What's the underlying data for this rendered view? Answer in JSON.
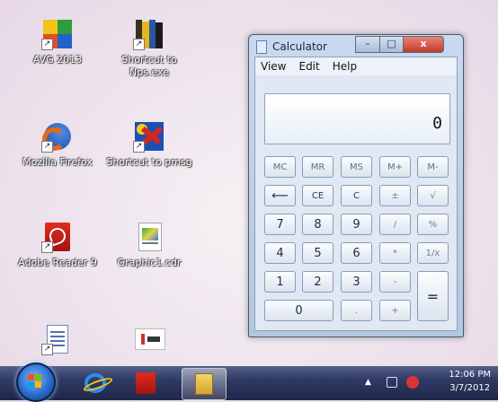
{
  "desktop": {
    "icons": [
      {
        "label": "AVG 2013",
        "icon": "avg-icon"
      },
      {
        "label": "Shortcut to Nps.exe",
        "icon": "books-icon"
      },
      {
        "label": "Mozilla Firefox",
        "icon": "firefox-icon"
      },
      {
        "label": "Shortcut to pmsg",
        "icon": "paint-icon"
      },
      {
        "label": "Adobe Reader 9",
        "icon": "adobe-reader-icon"
      },
      {
        "label": "Graphic1.cdr",
        "icon": "cdr-file-icon"
      },
      {
        "label": "",
        "icon": "document-icon"
      },
      {
        "label": "",
        "icon": "image-file-icon"
      }
    ]
  },
  "calculator": {
    "title": "Calculator",
    "menu": [
      "View",
      "Edit",
      "Help"
    ],
    "display": "0",
    "window_controls": {
      "minimize": "–",
      "maximize": "□",
      "close": "x"
    },
    "keys": {
      "mc": "MC",
      "mr": "MR",
      "ms": "MS",
      "mplus": "M+",
      "mminus": "M-",
      "back": "⟵",
      "ce": "CE",
      "c": "C",
      "plusminus": "±",
      "sqrt": "√",
      "k7": "7",
      "k8": "8",
      "k9": "9",
      "div": "/",
      "pct": "%",
      "k4": "4",
      "k5": "5",
      "k6": "6",
      "mul": "*",
      "recip": "1/x",
      "k1": "1",
      "k2": "2",
      "k3": "3",
      "sub": "-",
      "eq": "=",
      "k0": "0",
      "dot": ".",
      "add": "+"
    }
  },
  "taskbar": {
    "time": "12:06 PM",
    "date": "3/7/2012",
    "tray_arrow": "▲",
    "colors": {
      "accent": "#2b6bd0",
      "bar": "#2f3a63"
    }
  }
}
